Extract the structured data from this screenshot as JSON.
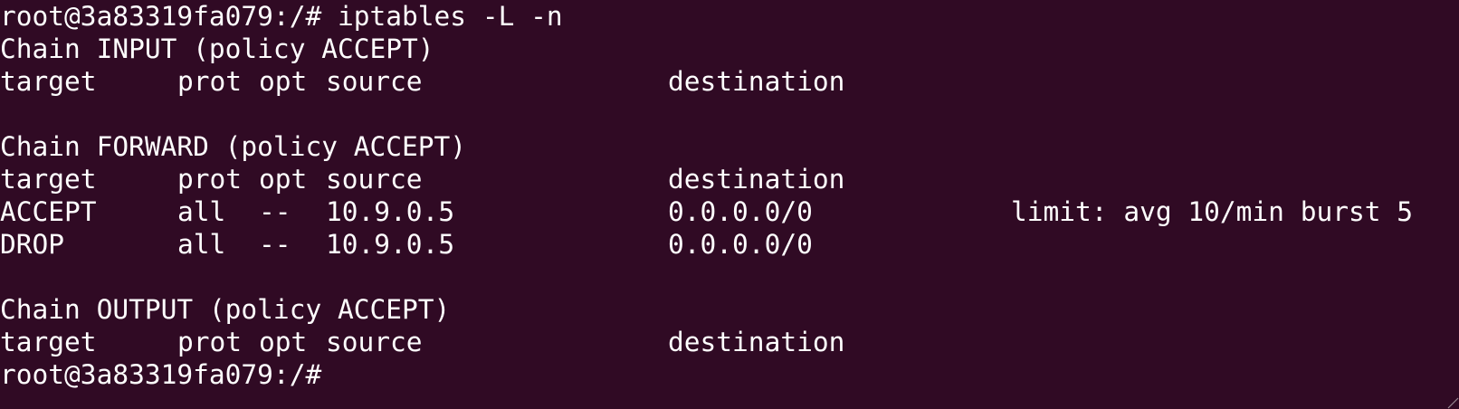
{
  "terminal": {
    "prompt": "root@3a83319fa079:/#",
    "command": " iptables -L -n",
    "chains": [
      {
        "header": "Chain INPUT (policy ACCEPT)",
        "columns": {
          "target": "target",
          "prot": "prot",
          "opt": "opt",
          "source": "source",
          "destination": "destination"
        },
        "rows": []
      },
      {
        "header": "Chain FORWARD (policy ACCEPT)",
        "columns": {
          "target": "target",
          "prot": "prot",
          "opt": "opt",
          "source": "source",
          "destination": "destination"
        },
        "rows": [
          {
            "target": "ACCEPT",
            "prot": "all",
            "opt": "--",
            "source": "10.9.0.5",
            "destination": "0.0.0.0/0",
            "extra": "limit: avg 10/min burst 5"
          },
          {
            "target": "DROP",
            "prot": "all",
            "opt": "--",
            "source": "10.9.0.5",
            "destination": "0.0.0.0/0",
            "extra": ""
          }
        ]
      },
      {
        "header": "Chain OUTPUT (policy ACCEPT)",
        "columns": {
          "target": "target",
          "prot": "prot",
          "opt": "opt",
          "source": "source",
          "destination": "destination"
        },
        "rows": []
      }
    ],
    "final_prompt": "root@3a83319fa079:/#",
    "colors": {
      "background": "#300a24",
      "foreground": "#ffffff"
    }
  }
}
